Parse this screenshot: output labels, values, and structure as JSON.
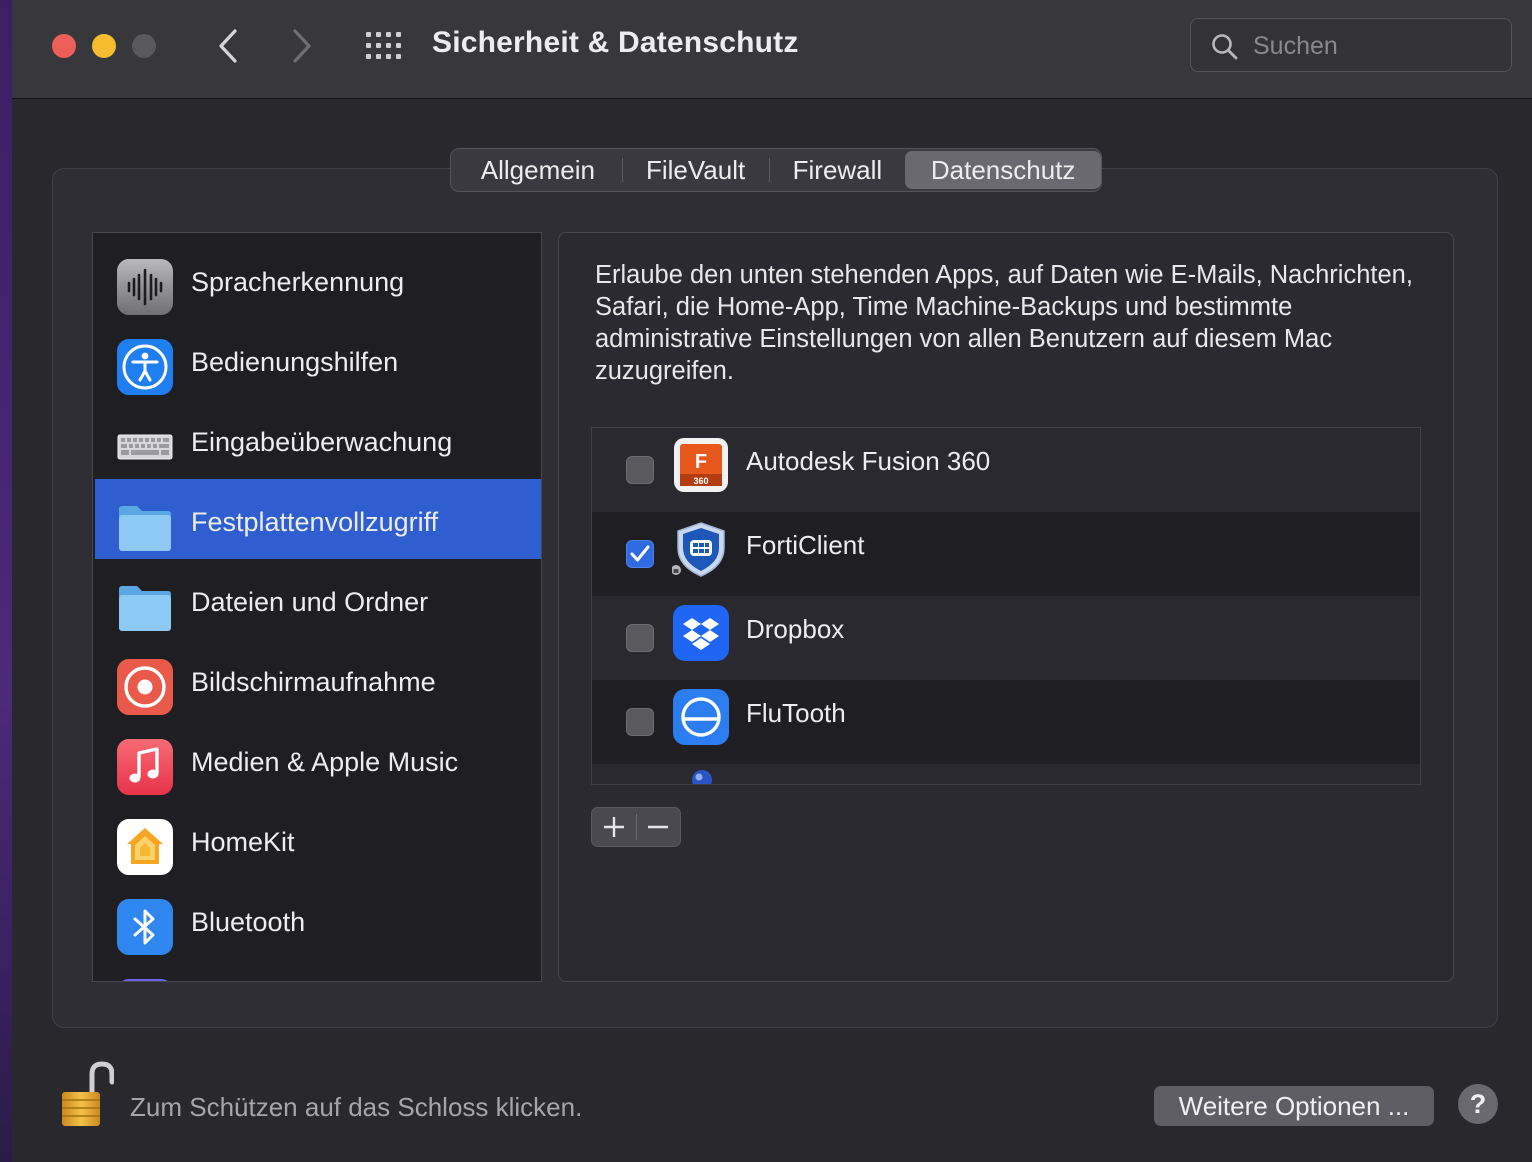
{
  "window": {
    "title": "Sicherheit & Datenschutz",
    "search_placeholder": "Suchen"
  },
  "tabs": [
    {
      "label": "Allgemein",
      "selected": false
    },
    {
      "label": "FileVault",
      "selected": false
    },
    {
      "label": "Firewall",
      "selected": false
    },
    {
      "label": "Datenschutz",
      "selected": true
    }
  ],
  "sidebar": {
    "items": [
      {
        "label": "Spracherkennung",
        "icon": "waveform-icon"
      },
      {
        "label": "Bedienungshilfen",
        "icon": "accessibility-icon"
      },
      {
        "label": "Eingabeüberwachung",
        "icon": "keyboard-icon"
      },
      {
        "label": "Festplattenvollzugriff",
        "icon": "folder-icon",
        "selected": true
      },
      {
        "label": "Dateien und Ordner",
        "icon": "folder-icon"
      },
      {
        "label": "Bildschirmaufnahme",
        "icon": "screen-record-icon"
      },
      {
        "label": "Medien & Apple Music",
        "icon": "music-note-icon"
      },
      {
        "label": "HomeKit",
        "icon": "home-icon"
      },
      {
        "label": "Bluetooth",
        "icon": "bluetooth-icon"
      }
    ]
  },
  "content": {
    "description": "Erlaube den unten stehenden Apps, auf Daten wie E-Mails, Nachrichten, Safari, die Home-App, Time Machine-Backups und bestimmte administrative Einstellungen von allen Benutzern auf diesem Mac zuzugreifen.",
    "apps": [
      {
        "name": "Autodesk Fusion 360",
        "checked": false,
        "icon": "fusion360-icon",
        "icon_text_top": "F",
        "icon_text_bottom": "360"
      },
      {
        "name": "FortiClient",
        "checked": true,
        "icon": "forticlient-shield-icon"
      },
      {
        "name": "Dropbox",
        "checked": false,
        "icon": "dropbox-icon"
      },
      {
        "name": "FluTooth",
        "checked": false,
        "icon": "flutooth-icon"
      }
    ],
    "add_symbol": "+",
    "remove_symbol": "−"
  },
  "footer": {
    "lock_text": "Zum Schützen auf das Schloss klicken.",
    "more_options_label": "Weitere Optionen ...",
    "help_label": "?"
  },
  "colors": {
    "selection_blue": "#2e5ecf",
    "checkbox_blue": "#2f6ae0",
    "traffic_red": "#ee5f57",
    "traffic_yellow": "#f5bd2e"
  }
}
